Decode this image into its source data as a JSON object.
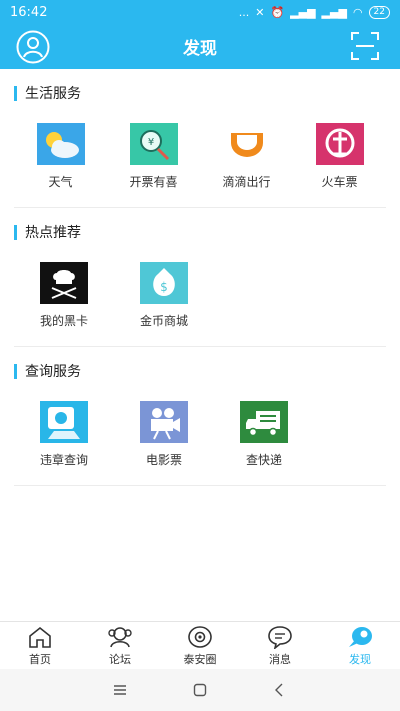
{
  "status": {
    "time": "16:42",
    "signal": "...",
    "battery": "22"
  },
  "header": {
    "title": "发现"
  },
  "sections": [
    {
      "title": "生活服务",
      "items": [
        {
          "label": "天气",
          "icon": "weather-icon"
        },
        {
          "label": "开票有喜",
          "icon": "invoice-icon"
        },
        {
          "label": "滴滴出行",
          "icon": "didi-icon"
        },
        {
          "label": "火车票",
          "icon": "train-ticket-icon"
        }
      ]
    },
    {
      "title": "热点推荐",
      "items": [
        {
          "label": "我的黑卡",
          "icon": "black-card-icon"
        },
        {
          "label": "金币商城",
          "icon": "coin-mall-icon"
        }
      ]
    },
    {
      "title": "查询服务",
      "items": [
        {
          "label": "违章查询",
          "icon": "violation-query-icon"
        },
        {
          "label": "电影票",
          "icon": "movie-ticket-icon"
        },
        {
          "label": "查快递",
          "icon": "express-query-icon"
        }
      ]
    }
  ],
  "tabs": [
    {
      "label": "首页",
      "icon": "home-icon"
    },
    {
      "label": "论坛",
      "icon": "forum-icon"
    },
    {
      "label": "泰安圈",
      "icon": "circle-icon"
    },
    {
      "label": "消息",
      "icon": "message-icon"
    },
    {
      "label": "发现",
      "icon": "discover-icon",
      "active": true
    }
  ],
  "colors": {
    "accent": "#2bb8ef",
    "weather": "#3aa6e8",
    "invoice": "#37c7a7",
    "didi": "#f08a1c",
    "train": "#d6336c",
    "black_card": "#111111",
    "coin": "#4fc7d6",
    "violation": "#29b6e8",
    "movie": "#7b95d6",
    "express": "#2e8b3e"
  }
}
